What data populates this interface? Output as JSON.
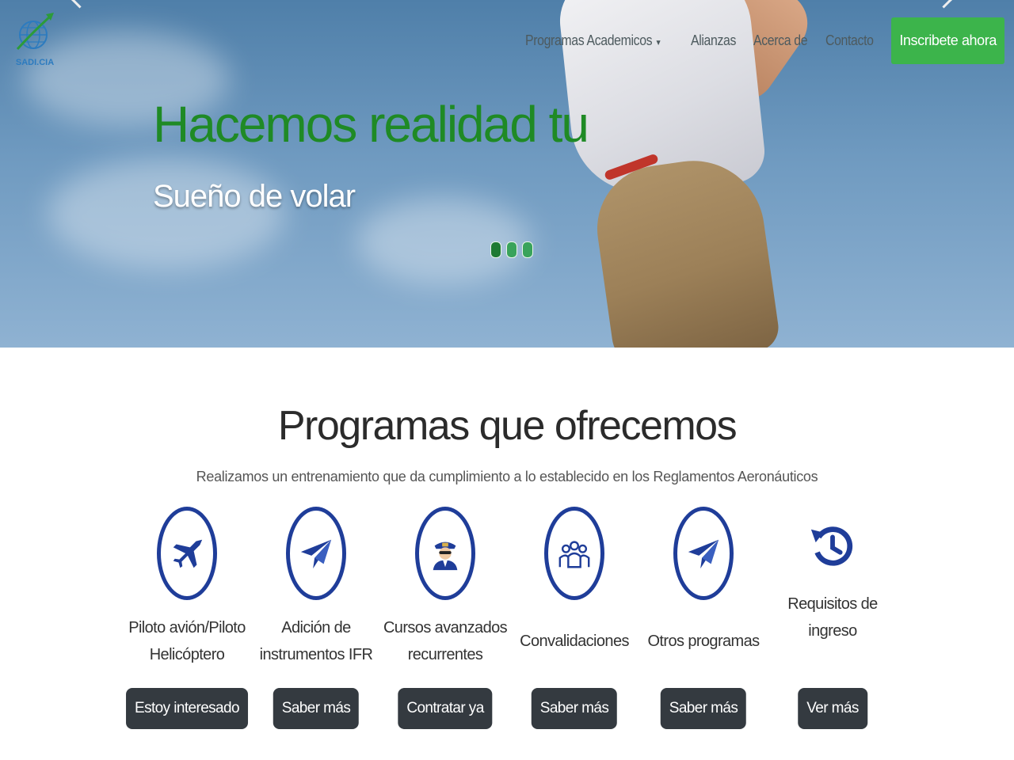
{
  "brand": {
    "logo_text": "SADI.CIA"
  },
  "nav": {
    "items": [
      "Programas Academicos",
      "Alianzas",
      "Acerca de",
      "Contacto"
    ],
    "cta": "Inscribete ahora"
  },
  "hero": {
    "title": "Hacemos realidad tu",
    "subtitle": "Sueño de volar",
    "slides": 3,
    "active_slide": 1
  },
  "programs": {
    "title": "Programas que ofrecemos",
    "subtitle": "Realizamos un entrenamiento que da cumplimiento a lo establecido en los Reglamentos Aeronáuticos",
    "cards": [
      {
        "label": "Piloto avión/Piloto Helicóptero",
        "button": "Estoy interesado",
        "icon": "airplane-icon"
      },
      {
        "label": "Adición de instrumentos IFR",
        "button": "Saber más",
        "icon": "paper-plane-icon"
      },
      {
        "label": "Cursos avanzados recurrentes",
        "button": "Contratar ya",
        "icon": "pilot-icon"
      },
      {
        "label": "Convalidaciones",
        "button": "Saber más",
        "icon": "group-icon"
      },
      {
        "label": "Otros programas",
        "button": "Saber más",
        "icon": "paper-plane-icon"
      },
      {
        "label": "Requisitos de ingreso",
        "button": "Ver más",
        "icon": "history-icon"
      }
    ]
  },
  "colors": {
    "brand_green": "#1f8a25",
    "cta_green": "#3cb44b",
    "icon_blue": "#1f3d99",
    "button_dark": "#343a40"
  }
}
